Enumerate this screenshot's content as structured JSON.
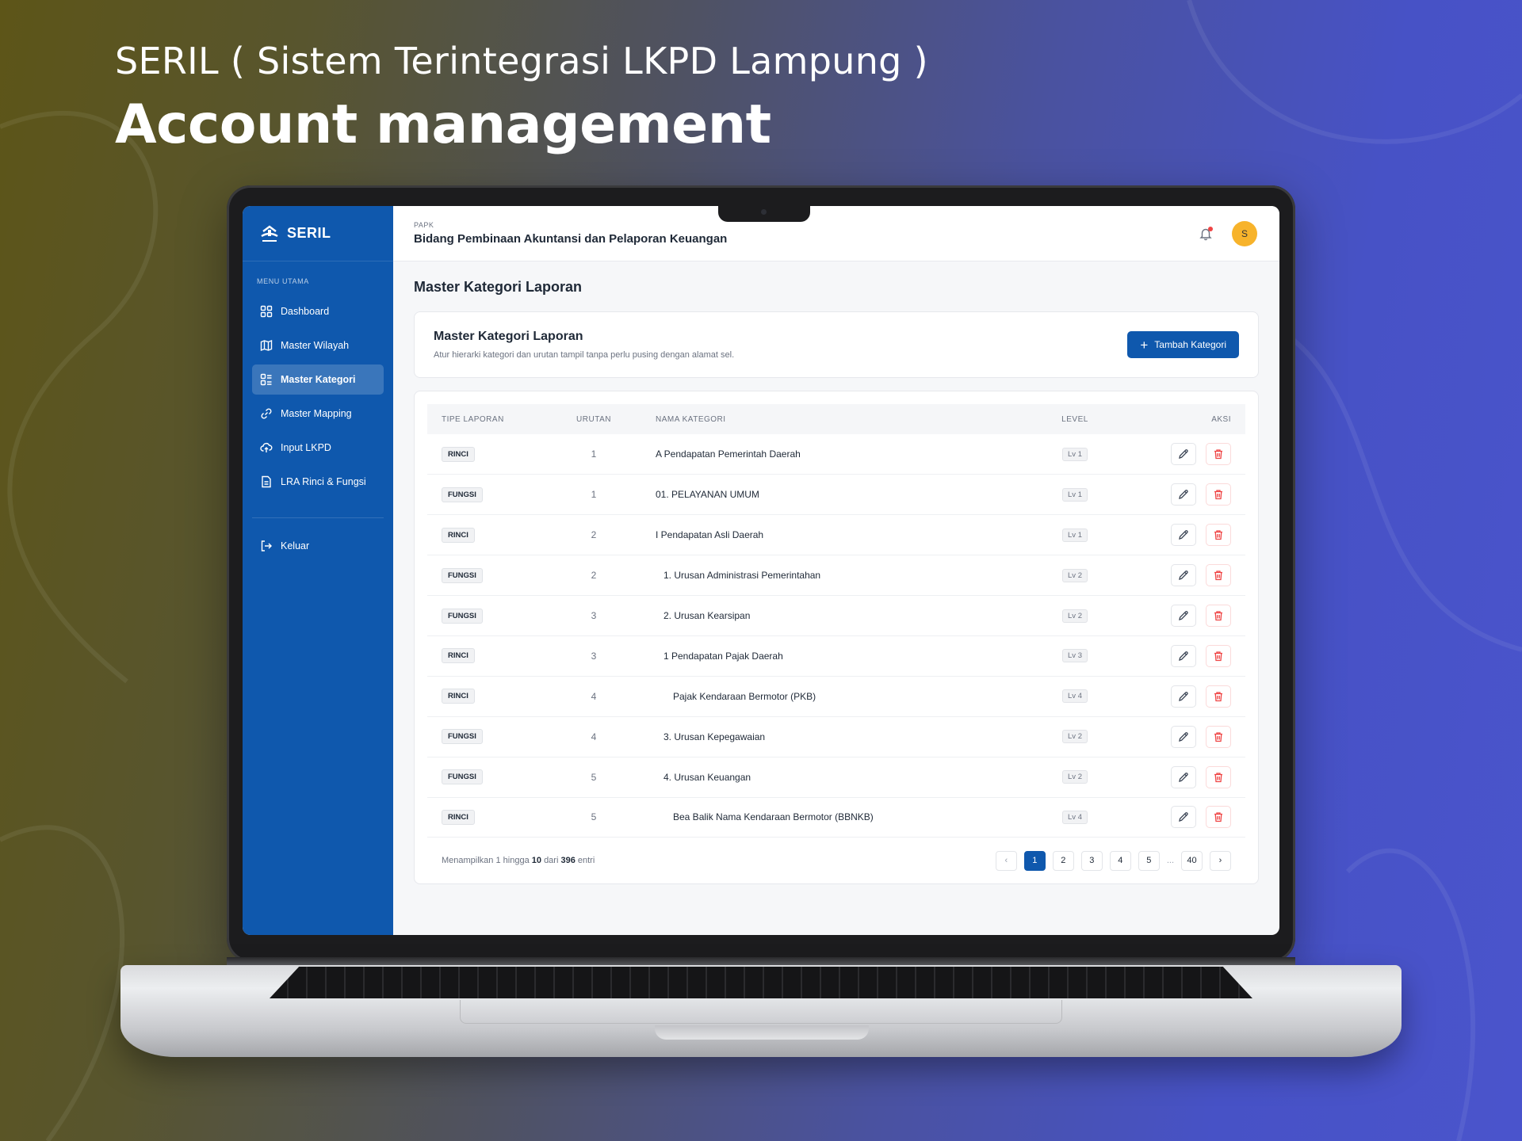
{
  "hero": {
    "subtitle": "SERIL ( Sistem Terintegrasi LKPD Lampung )",
    "title": "Account management"
  },
  "app": {
    "logo_text": "SERIL",
    "menu_heading": "MENU UTAMA",
    "nav": [
      {
        "label": "Dashboard",
        "icon": "grid-icon"
      },
      {
        "label": "Master Wilayah",
        "icon": "map-icon"
      },
      {
        "label": "Master Kategori",
        "icon": "category-icon",
        "active": true
      },
      {
        "label": "Master Mapping",
        "icon": "link-icon"
      },
      {
        "label": "Input LKPD",
        "icon": "cloud-upload-icon"
      },
      {
        "label": "LRA Rinci & Fungsi",
        "icon": "document-icon"
      }
    ],
    "logout_label": "Keluar",
    "accent_color": "#0f58ad"
  },
  "topbar": {
    "org_short": "PAPK",
    "org_name": "Bidang Pembinaan Akuntansi dan Pelaporan Keuangan",
    "avatar_initial": "S"
  },
  "page": {
    "title": "Master Kategori Laporan",
    "card_title": "Master Kategori Laporan",
    "card_desc": "Atur hierarki kategori dan urutan tampil tanpa perlu pusing dengan alamat sel.",
    "add_button": "Tambah Kategori"
  },
  "table": {
    "headers": [
      "TIPE LAPORAN",
      "URUTAN",
      "NAMA KATEGORI",
      "LEVEL",
      "AKSI"
    ],
    "rows": [
      {
        "tipe": "RINCI",
        "urutan": "1",
        "nama": "A Pendapatan Pemerintah Daerah",
        "level": "Lv 1"
      },
      {
        "tipe": "FUNGSI",
        "urutan": "1",
        "nama": "01. PELAYANAN UMUM",
        "level": "Lv 1"
      },
      {
        "tipe": "RINCI",
        "urutan": "2",
        "nama": "I Pendapatan Asli Daerah",
        "level": "Lv 1"
      },
      {
        "tipe": "FUNGSI",
        "urutan": "2",
        "nama": "1. Urusan Administrasi Pemerintahan",
        "level": "Lv 2"
      },
      {
        "tipe": "FUNGSI",
        "urutan": "3",
        "nama": "2. Urusan Kearsipan",
        "level": "Lv 2"
      },
      {
        "tipe": "RINCI",
        "urutan": "3",
        "nama": "1 Pendapatan Pajak Daerah",
        "level": "Lv 3"
      },
      {
        "tipe": "RINCI",
        "urutan": "4",
        "nama": "Pajak Kendaraan Bermotor (PKB)",
        "level": "Lv 4"
      },
      {
        "tipe": "FUNGSI",
        "urutan": "4",
        "nama": "3. Urusan Kepegawaian",
        "level": "Lv 2"
      },
      {
        "tipe": "FUNGSI",
        "urutan": "5",
        "nama": "4. Urusan Keuangan",
        "level": "Lv 2"
      },
      {
        "tipe": "RINCI",
        "urutan": "5",
        "nama": "Bea Balik Nama Kendaraan Bermotor (BBNKB)",
        "level": "Lv 4"
      }
    ],
    "footer": {
      "prefix": "Menampilkan 1 hingga",
      "shown": "10",
      "middle": "dari",
      "total": "396",
      "suffix": "entri"
    },
    "pagination": {
      "prev": "‹",
      "pages": [
        "1",
        "2",
        "3",
        "4",
        "5"
      ],
      "ellipsis": "...",
      "last": "40",
      "next": "›",
      "current": "1"
    }
  }
}
